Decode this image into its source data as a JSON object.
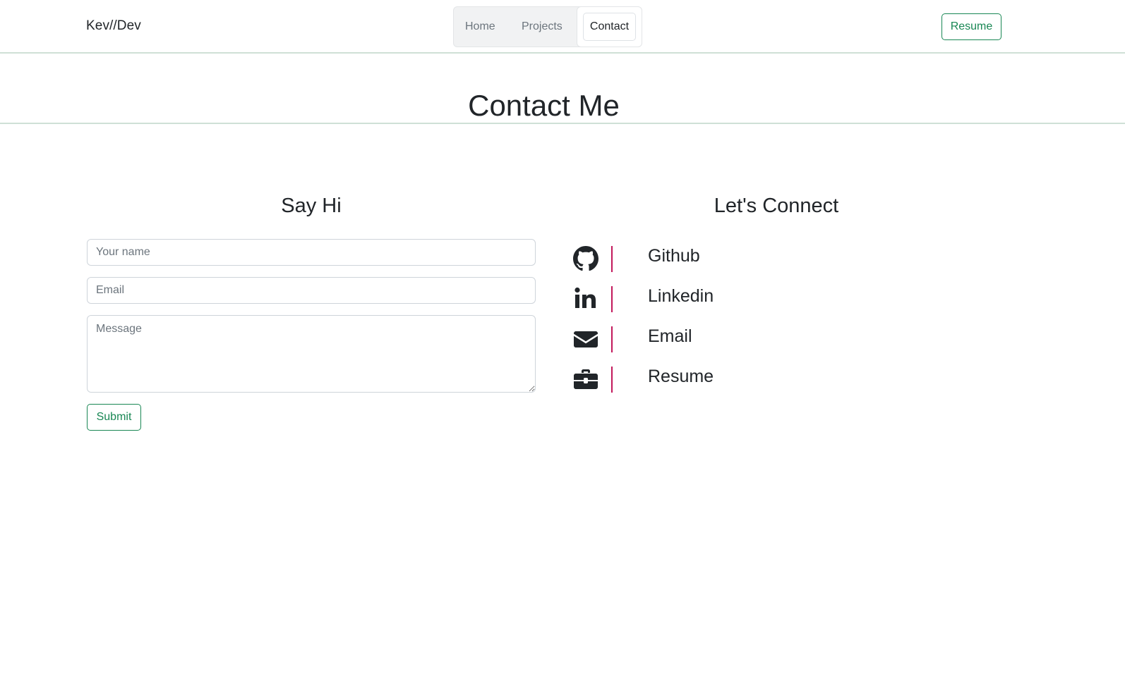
{
  "nav": {
    "brand": "Kev//Dev",
    "links": {
      "home": "Home",
      "projects": "Projects",
      "contact": "Contact"
    },
    "active": "Contact",
    "resume_label": "Resume",
    "accent_color": "#198754"
  },
  "hero": {
    "title": "Contact Me"
  },
  "form": {
    "heading": "Say Hi",
    "name_placeholder": "Your name",
    "email_placeholder": "Email",
    "message_placeholder": "Message",
    "submit_label": "Submit"
  },
  "connect": {
    "heading": "Let's Connect",
    "divider_color": "#c2185b",
    "items": [
      {
        "label": "Github",
        "icon": "github-icon"
      },
      {
        "label": "Linkedin",
        "icon": "linkedin-icon"
      },
      {
        "label": "Email",
        "icon": "envelope-icon"
      },
      {
        "label": "Resume",
        "icon": "briefcase-icon"
      }
    ]
  }
}
